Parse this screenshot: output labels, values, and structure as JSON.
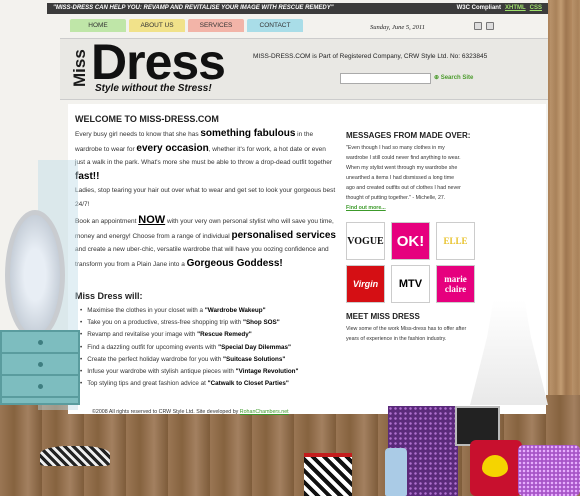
{
  "topbar": {
    "slogan": "\"MISS-DRESS CAN HELP YOU: REVAMP AND REVITALISE YOUR IMAGE WITH RESCUE REMEDY\"",
    "w3c": "W3C Compliant",
    "xhtml": "XHTML",
    "css": "CSS"
  },
  "nav": {
    "home": "HOME",
    "about": "ABOUT US",
    "services": "SERVICES",
    "contact": "CONTACT"
  },
  "date": "Sunday, June 5, 2011",
  "logo": {
    "miss": "Miss",
    "dress": "Dress",
    "tagline": "Style without the Stress!"
  },
  "header": {
    "registration": "MISS-DRESS.COM is Part of Registered Company, CRW Style Ltd. No: 6323845",
    "search_label": "Search Site"
  },
  "welcome": {
    "title": "WELCOME TO MISS-DRESS.COM",
    "p1a": "Every busy girl needs to know that she has ",
    "p1b": "something fabulous",
    "p1c": " in the wardrobe to wear for ",
    "p1d": "every occasion",
    "p1e": ", whether it's for work, a hot date or even just a walk in the park. What's more she must be able to throw a drop-dead outfit together ",
    "p1f": "fast!!",
    "p2": "Ladies, stop tearing your hair out over what to wear and get set to look your gorgeous best 24/7!",
    "p3a": "Book an appointment ",
    "p3b": "NOW",
    "p3c": " with your very own personal stylist who will save you time, money and energy! Choose from a range of individual ",
    "p3d": "personalised services",
    "p3e": " and create a new uber-chic, versatile wardrobe that will have you oozing confidence and transform you from a Plain Jane into a ",
    "p3f": "Gorgeous Goddess!"
  },
  "will": {
    "title": "Miss Dress will:",
    "items": [
      {
        "text": "Maximise the clothes in your closet with a ",
        "bold": "\"Wardrobe Wakeup\""
      },
      {
        "text": "Take you on a productive, stress-free shopping trip with ",
        "bold": "\"Shop SOS\""
      },
      {
        "text": "Revamp and revitalise your image with ",
        "bold": "\"Rescue Remedy\""
      },
      {
        "text": "Find a dazzling outfit for upcoming events with ",
        "bold": "\"Special Day Dilemmas\""
      },
      {
        "text": "Create the perfect holiday wardrobe for you with ",
        "bold": "\"Suitcase Solutions\""
      },
      {
        "text": "Infuse your wardrobe with stylish antique pieces with ",
        "bold": "\"Vintage Revolution\""
      },
      {
        "text": "Top styling tips and great fashion advice at ",
        "bold": "\"Catwalk to Closet Parties\""
      }
    ]
  },
  "messages": {
    "title": "MESSAGES FROM MADE OVER:",
    "quote": "\"Even though I had so many clothes in my wardrobe I still could never find anything to wear. When my stylist went through my wardrobe she unearthed a items I had dismissed a long time ago and created outfits out of clothes I had never thought of putting together.\" - Michelle, 27.",
    "more": "Find out more..."
  },
  "press_logos": [
    "VOGUE",
    "OK!",
    "ELLE",
    "Virgin",
    "MTV",
    "marie claire"
  ],
  "meet": {
    "title": "MEET MISS DRESS",
    "text": "View some of the work Miss-dress has to offer after years of experience in the fashion industry."
  },
  "footer": {
    "copyright": "©2008 All rights reserved to CRW Style Ltd. Site developed by ",
    "developer": "RohanChambers.net"
  }
}
